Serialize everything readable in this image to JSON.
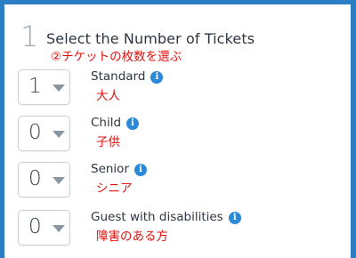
{
  "step": {
    "number": "1",
    "title": "Select the Number of Tickets",
    "annotation": "②チケットの枚数を選ぶ"
  },
  "ticket_rows": [
    {
      "quantity": "1",
      "label": "Standard",
      "annotation": "大人",
      "icon": "info-icon"
    },
    {
      "quantity": "0",
      "label": "Child",
      "annotation": "子供",
      "icon": "info-icon"
    },
    {
      "quantity": "0",
      "label": "Senior",
      "annotation": "シニア",
      "icon": "info-icon"
    },
    {
      "quantity": "0",
      "label": "Guest with disabilities",
      "annotation": "障害のある方",
      "icon": "info-icon"
    }
  ],
  "colors": {
    "frame_border": "#2a7fc4",
    "annotation_red": "#e0120f",
    "info_blue": "#2b89d8"
  }
}
